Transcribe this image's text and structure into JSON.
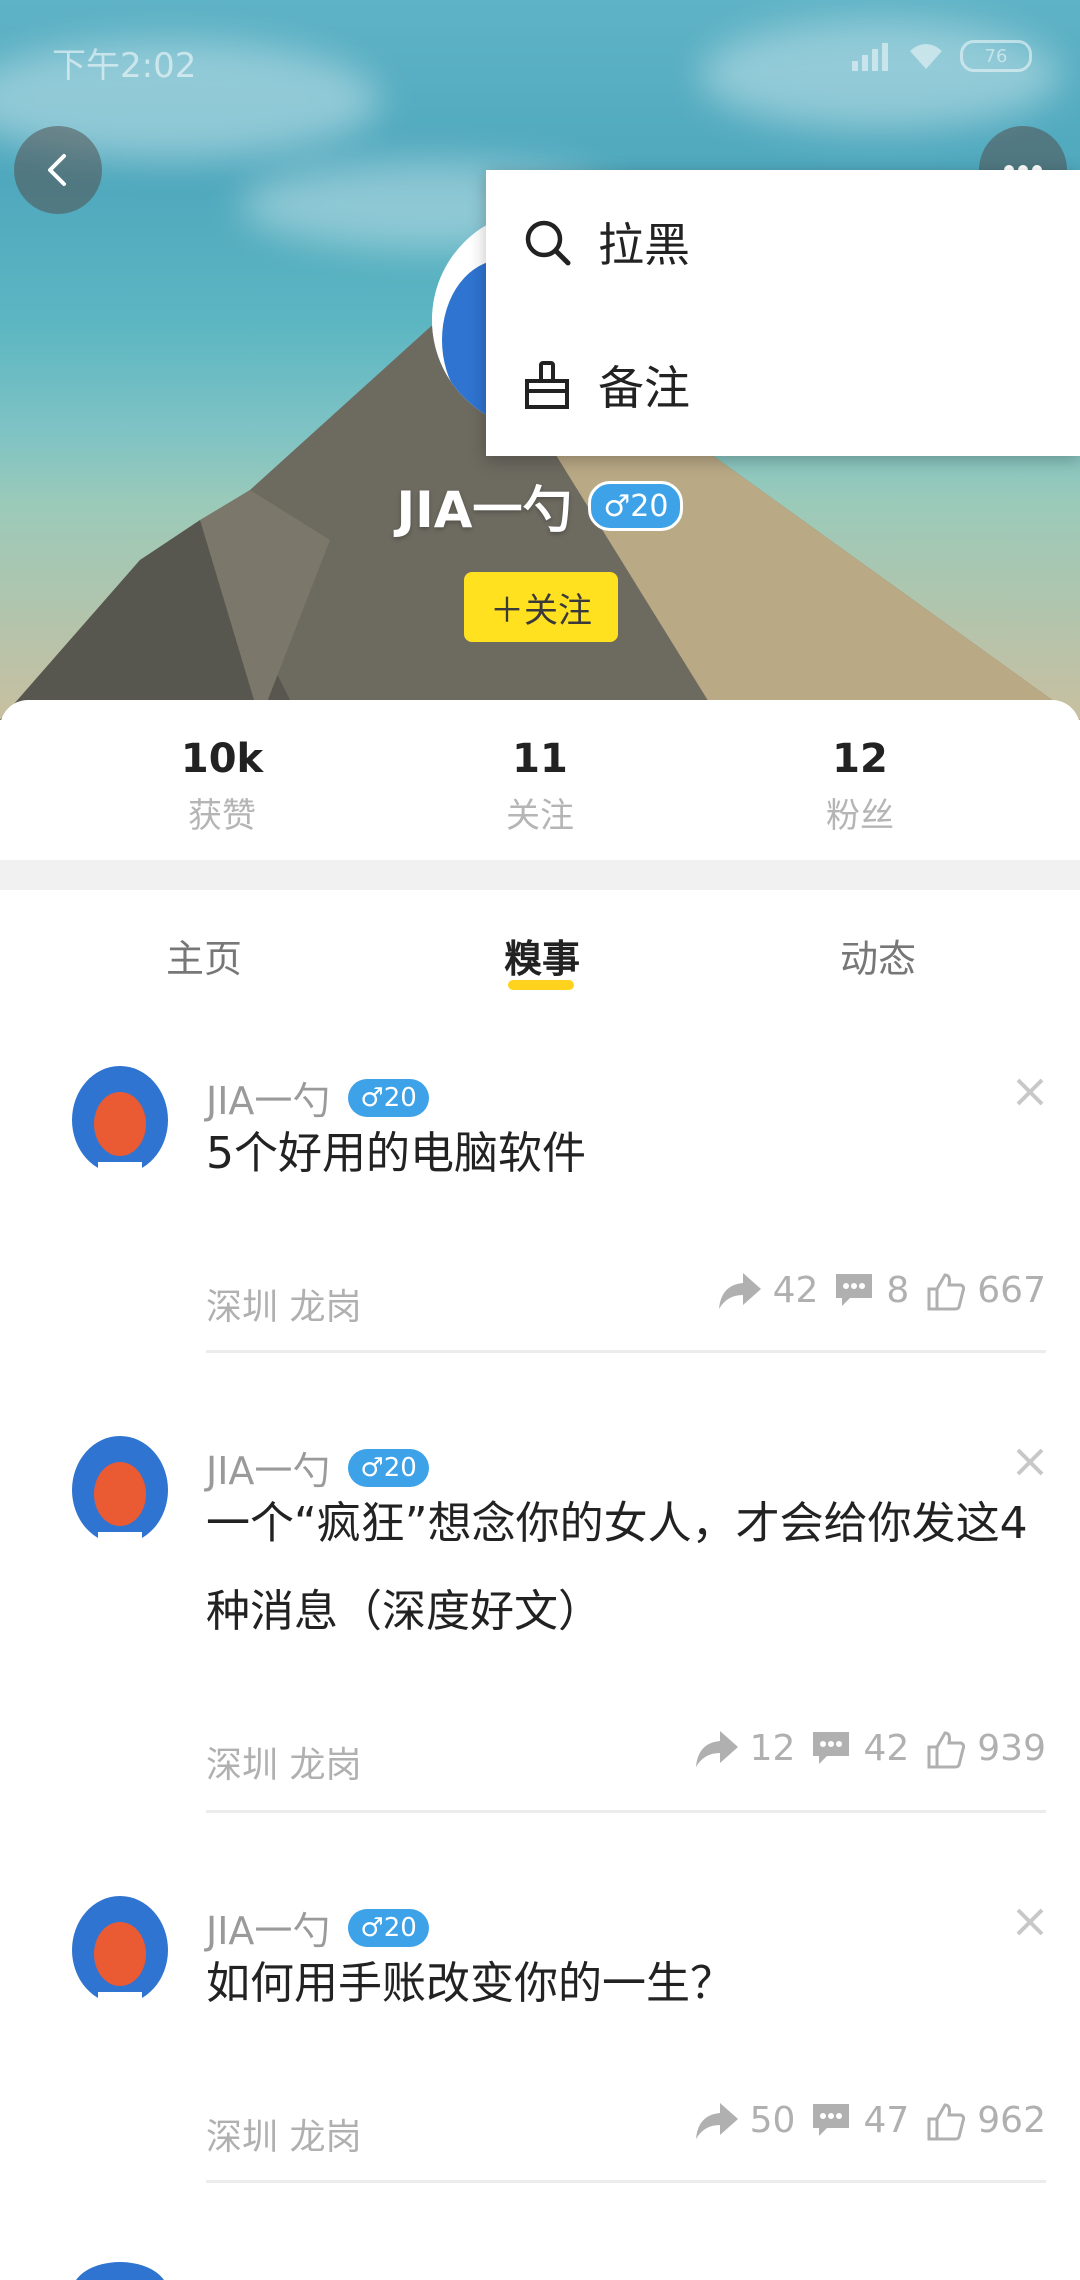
{
  "status_bar": {
    "time": "下午2:02",
    "battery": "76"
  },
  "profile": {
    "name": "JIA一勺",
    "gender_age": "♂20",
    "follow_label": "＋关注"
  },
  "popup_menu": {
    "items": [
      {
        "label": "拉黑",
        "icon": "search-icon"
      },
      {
        "label": "备注",
        "icon": "broom-icon"
      }
    ]
  },
  "stats": [
    {
      "value": "10k",
      "label": "获赞"
    },
    {
      "value": "11",
      "label": "关注"
    },
    {
      "value": "12",
      "label": "粉丝"
    }
  ],
  "tabs": [
    {
      "label": "主页"
    },
    {
      "label": "糗事",
      "active": true
    },
    {
      "label": "动态"
    }
  ],
  "posts": [
    {
      "user": "JIA一勺",
      "badge": "♂20",
      "title": "5个好用的电脑软件",
      "location": "深圳 龙岗",
      "shares": "42",
      "comments": "8",
      "likes": "667"
    },
    {
      "user": "JIA一勺",
      "badge": "♂20",
      "title": "一个“疯狂”想念你的女人，才会给你发这4种消息（深度好文）",
      "location": "深圳 龙岗",
      "shares": "12",
      "comments": "42",
      "likes": "939"
    },
    {
      "user": "JIA一勺",
      "badge": "♂20",
      "title": "如何用手账改变你的一生？",
      "location": "深圳 龙岗",
      "shares": "50",
      "comments": "47",
      "likes": "962"
    }
  ],
  "colors": {
    "accent_yellow": "#ffe11f",
    "badge_blue": "#3ea2e8",
    "tab_underline": "#ffd31d"
  }
}
